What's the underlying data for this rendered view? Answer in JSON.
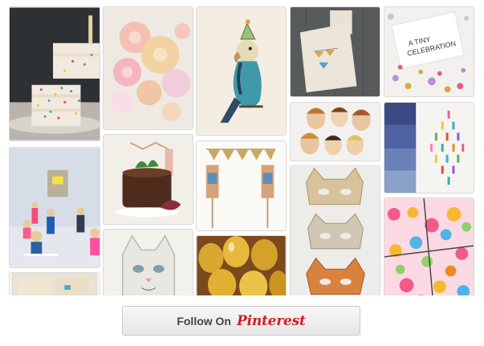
{
  "colors": {
    "pinterest_red": "#cb2027",
    "button_text": "#444444",
    "pin_border": "#d9d9d9"
  },
  "pins": [
    {
      "name": "pin-sprinkle-cake",
      "icon": "confetti-cake-icon"
    },
    {
      "name": "pin-paper-rosettes",
      "icon": "paper-rosette-icon"
    },
    {
      "name": "pin-parrot-party-hat",
      "icon": "parrot-icon"
    },
    {
      "name": "pin-favor-bags",
      "icon": "gift-bag-icon"
    },
    {
      "name": "pin-celebration-confetti",
      "icon": "confetti-card-icon",
      "card_text": "A TINY CELEBRATION"
    },
    {
      "name": "pin-sprinkle-cake-slice",
      "icon": "cake-slice-icon"
    },
    {
      "name": "pin-face-cookies",
      "icon": "cookie-icon"
    },
    {
      "name": "pin-tassel-garland",
      "icon": "tassel-icon"
    },
    {
      "name": "pin-peg-dolls",
      "icon": "peg-doll-icon"
    },
    {
      "name": "pin-chocolate-cake",
      "icon": "chocolate-cake-icon"
    },
    {
      "name": "pin-cake-topper-bunting",
      "icon": "bunting-icon"
    },
    {
      "name": "pin-animal-masks",
      "icon": "mask-icon"
    },
    {
      "name": "pin-confetti-gift",
      "icon": "gift-icon"
    },
    {
      "name": "pin-cat-embroidery",
      "icon": "cat-icon"
    },
    {
      "name": "pin-gold-balloons",
      "icon": "balloon-icon"
    },
    {
      "name": "pin-craft-bags",
      "icon": "bag-icon"
    }
  ],
  "follow_button": {
    "label": "Follow On",
    "brand": "Pinterest"
  }
}
